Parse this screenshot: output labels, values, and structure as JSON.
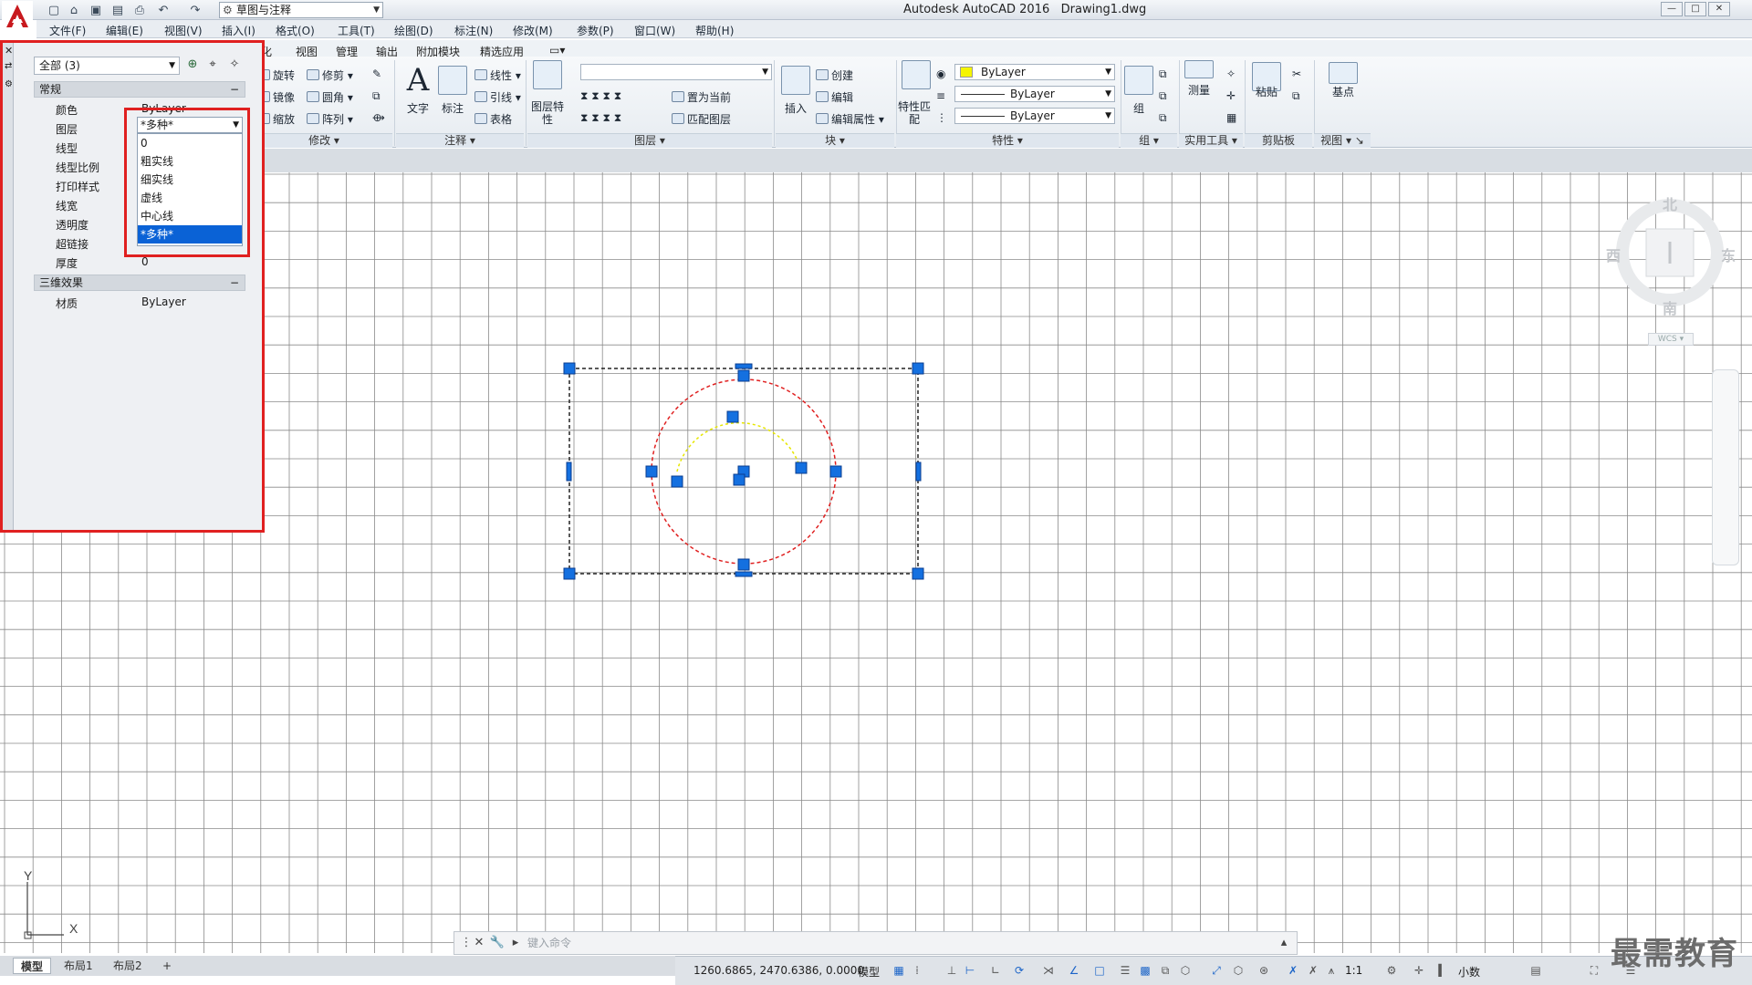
{
  "window": {
    "app_title": "Autodesk AutoCAD 2016",
    "file_name": "Drawing1.dwg",
    "workspace": "草图与注释",
    "controls": [
      "—",
      "□",
      "✕"
    ]
  },
  "menu": [
    "文件(F)",
    "编辑(E)",
    "视图(V)",
    "插入(I)",
    "格式(O)",
    "工具(T)",
    "绘图(D)",
    "标注(N)",
    "修改(M)",
    "参数(P)",
    "窗口(W)",
    "帮助(H)"
  ],
  "ribbon": {
    "tabs": [
      "化",
      "视图",
      "管理",
      "输出",
      "附加模块",
      "精选应用"
    ],
    "modify": {
      "title": "修改",
      "items": [
        "旋转",
        "修剪",
        "镜像",
        "圆角",
        "缩放",
        "阵列"
      ]
    },
    "annotation": {
      "title": "注释",
      "text": "文字",
      "dim": "标注",
      "items": [
        "线性",
        "引线",
        "表格"
      ]
    },
    "layers": {
      "title": "图层",
      "props": "图层特性",
      "items": [
        "置为当前",
        "匹配图层"
      ]
    },
    "block": {
      "title": "块",
      "insert": "插入",
      "items": [
        "创建",
        "编辑",
        "编辑属性"
      ]
    },
    "properties": {
      "title": "特性",
      "match": "特性匹配",
      "color": "ByLayer",
      "linetype": "ByLayer",
      "lineweight": "ByLayer"
    },
    "groups": {
      "title": "组",
      "group": "组"
    },
    "utilities": {
      "title": "实用工具",
      "measure": "测量"
    },
    "clipboard": {
      "title": "剪贴板",
      "paste": "粘贴"
    },
    "view": {
      "title": "视图",
      "base": "基点"
    }
  },
  "properties_palette": {
    "selection_filter": "全部 (3)",
    "sections": {
      "general": "常规",
      "3d": "三维效果"
    },
    "rows": [
      {
        "key": "颜色",
        "value": "ByLayer"
      },
      {
        "key": "图层",
        "value": ""
      },
      {
        "key": "线型",
        "value": ""
      },
      {
        "key": "线型比例",
        "value": ""
      },
      {
        "key": "打印样式",
        "value": ""
      },
      {
        "key": "线宽",
        "value": ""
      },
      {
        "key": "透明度",
        "value": ""
      },
      {
        "key": "超链接",
        "value": ""
      },
      {
        "key": "厚度",
        "value": "0"
      }
    ],
    "material": {
      "key": "材质",
      "value": "ByLayer"
    }
  },
  "layer_dropdown": {
    "current": "*多种*",
    "options": [
      "0",
      "粗实线",
      "细实线",
      "虚线",
      "中心线",
      "*多种*"
    ],
    "selected_index": 5
  },
  "viewcube": {
    "north": "北",
    "south": "南",
    "east": "东",
    "west": "西",
    "wcs": "WCS"
  },
  "ucs": {
    "x": "X",
    "y": "Y"
  },
  "command_line": {
    "placeholder": "键入命令"
  },
  "layout_tabs": [
    "模型",
    "布局1",
    "布局2",
    "+"
  ],
  "status": {
    "coords": "1260.6865, 2470.6386, 0.0000",
    "model": "模型",
    "scale": "1:1",
    "units": "小数"
  },
  "watermark": "最需教育",
  "colors": {
    "accent_red": "#e02020",
    "grip_blue": "#1470e0",
    "circle_red": "#e02020",
    "arc_yellow": "#e6e600",
    "grid_line": "#8a8a8a"
  }
}
